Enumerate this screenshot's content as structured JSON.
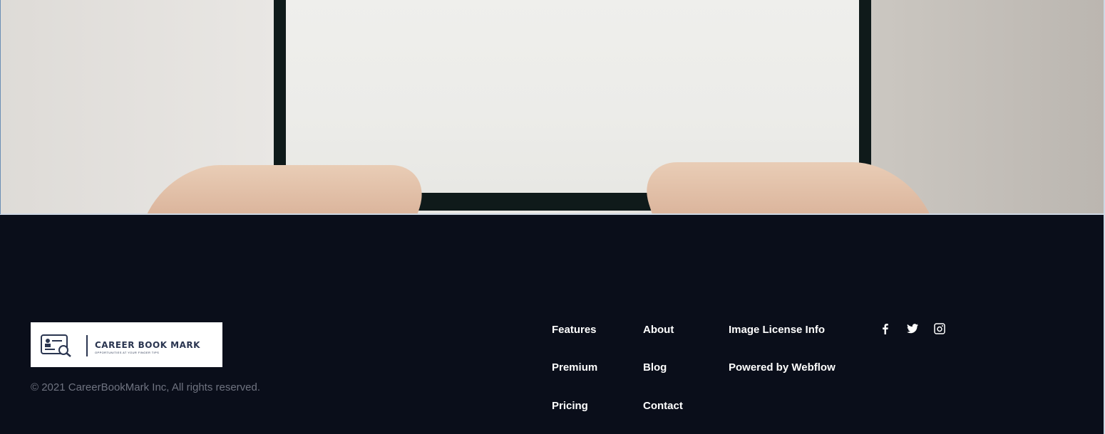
{
  "hero": {
    "alt": "hands on laptop"
  },
  "logo": {
    "name": "CAREER BOOK MARK",
    "tagline": "OPPORTUNITIES AT YOUR FINGER TIPS"
  },
  "footer": {
    "copyright": "© 2021 CareerBookMark Inc, All rights reserved.",
    "nav_col1": [
      "Features",
      "Premium",
      "Pricing"
    ],
    "nav_col2": [
      "About",
      "Blog",
      "Contact"
    ],
    "nav_col3": [
      "Image License Info",
      "Powered by Webflow"
    ]
  },
  "social": [
    {
      "icon": "facebook-icon"
    },
    {
      "icon": "twitter-icon"
    },
    {
      "icon": "instagram-icon"
    }
  ],
  "colors": {
    "footer_bg": "#0a0e1a",
    "link": "#ffffff",
    "muted": "#6f7380",
    "logo_ink": "#2a3550"
  }
}
